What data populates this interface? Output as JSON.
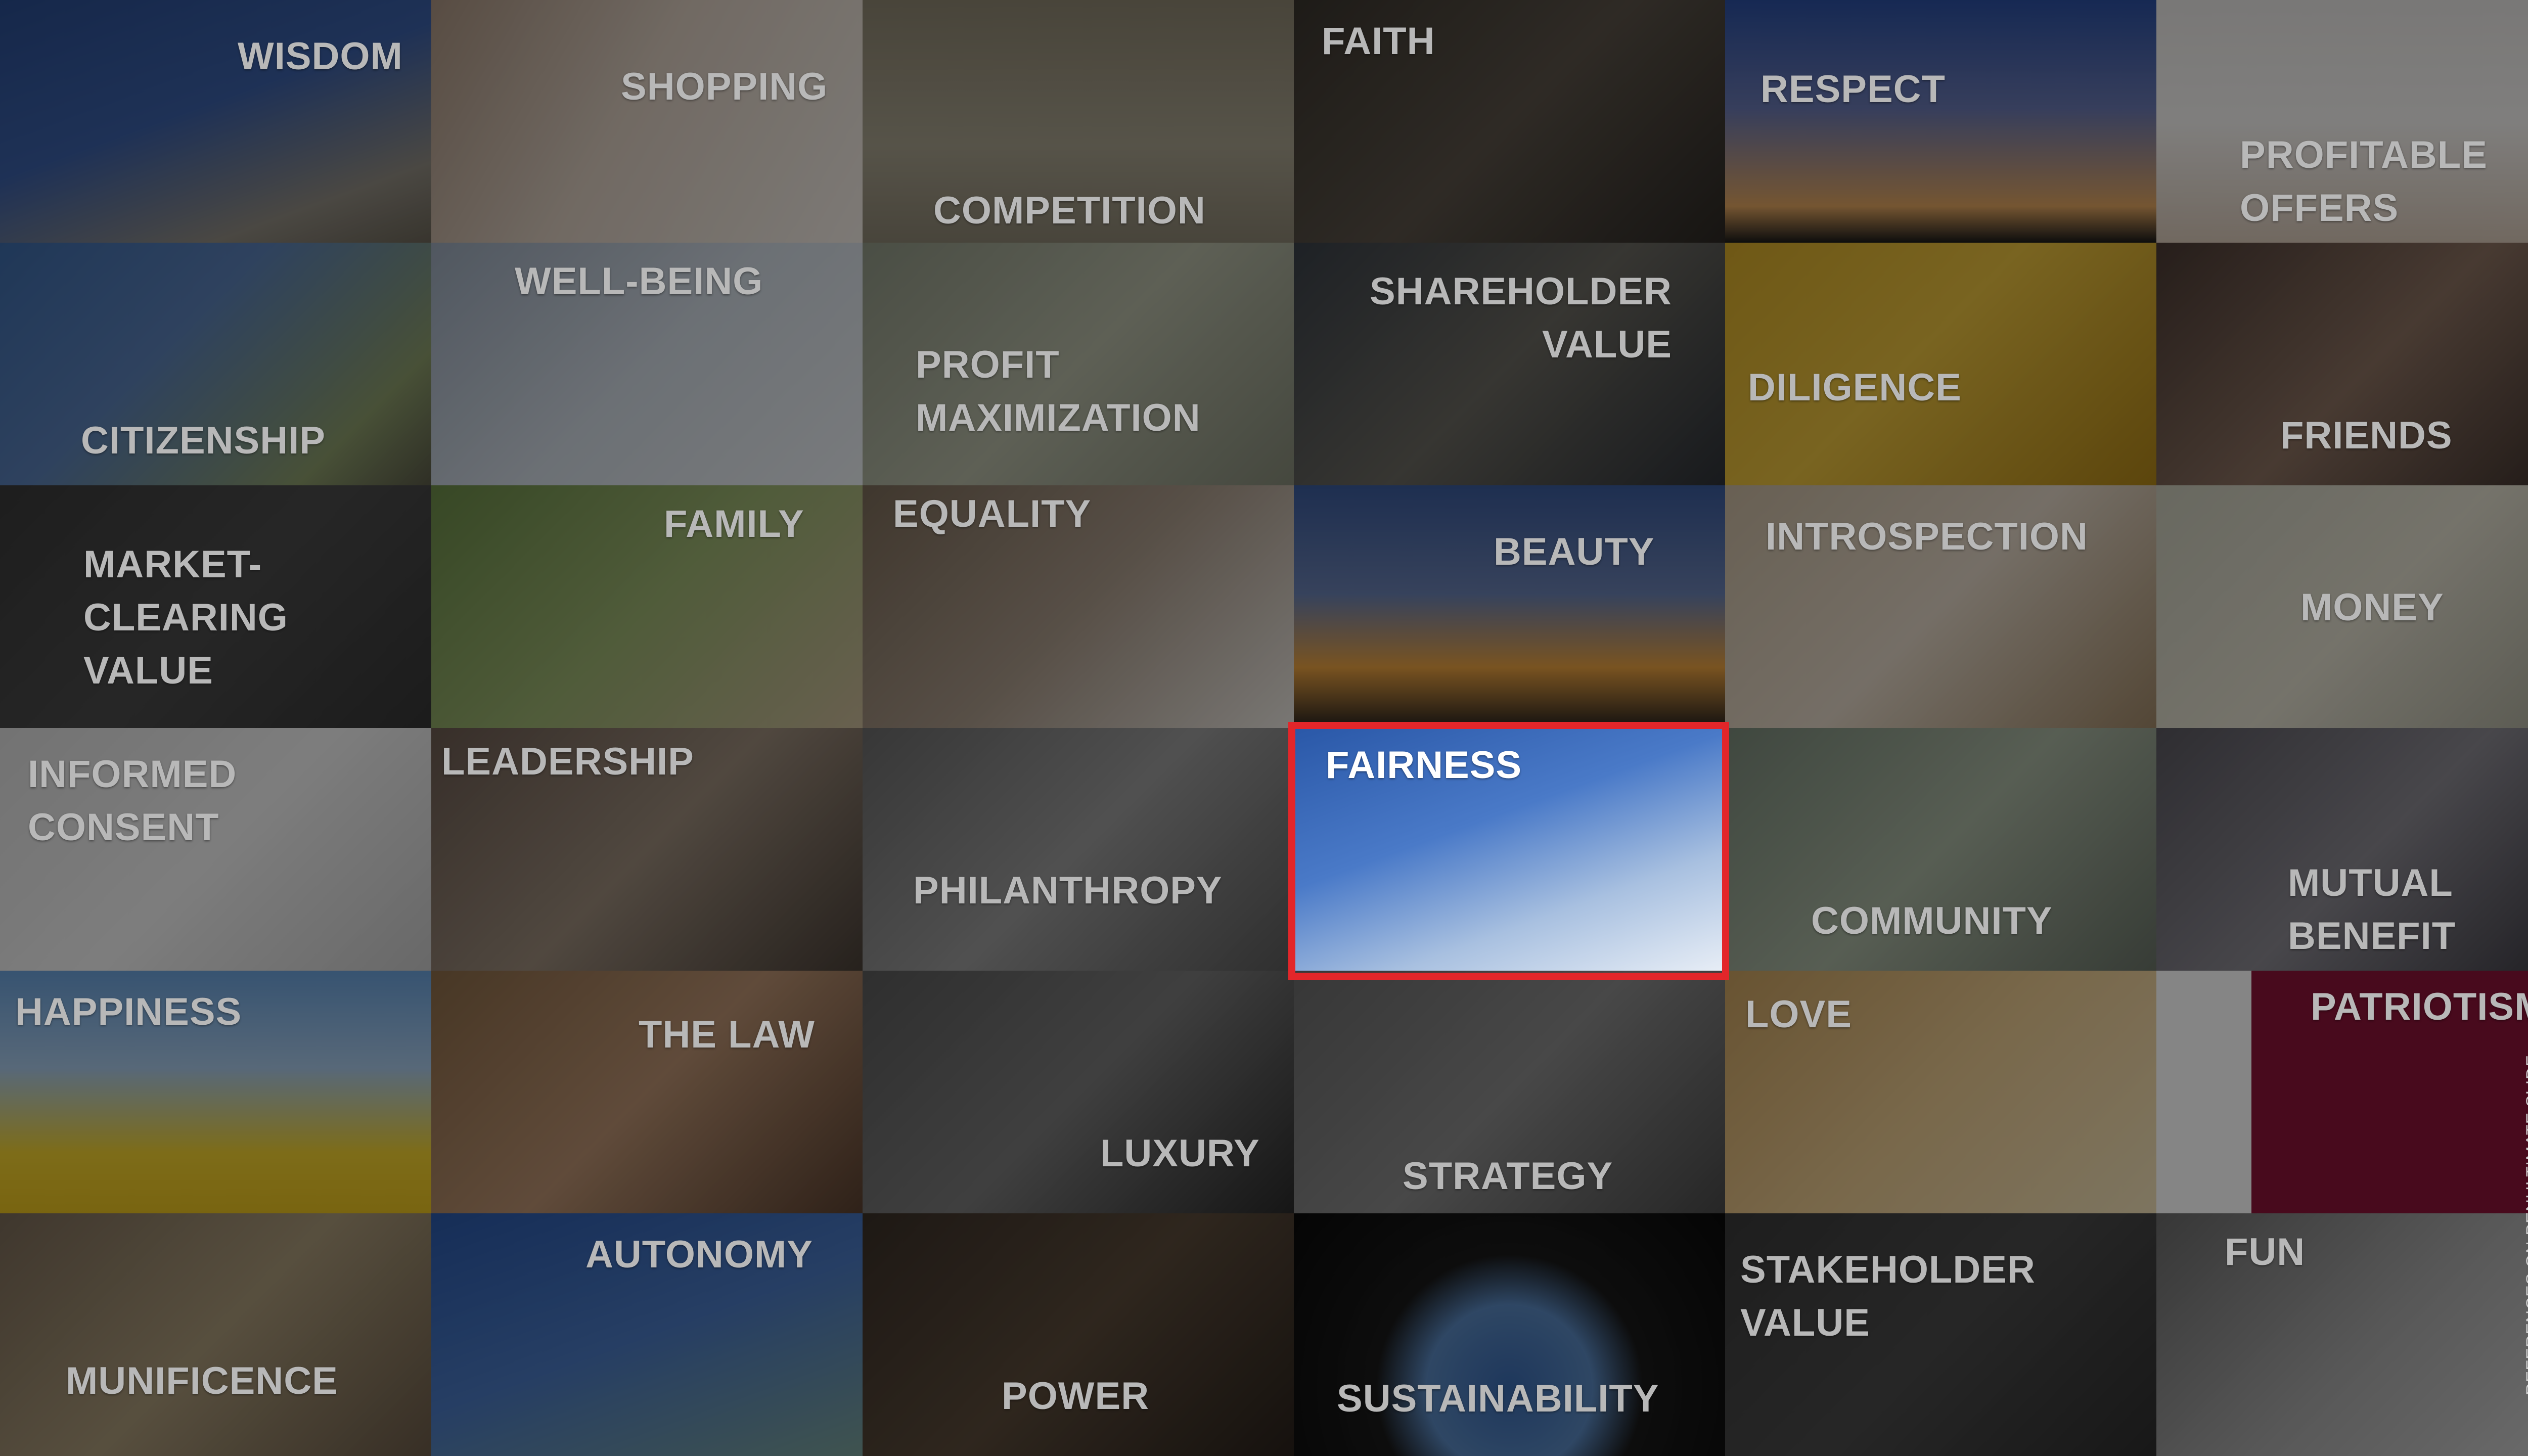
{
  "tiles": [
    {
      "id": "wisdom",
      "label": "WISDOM",
      "bg": "linear-gradient(160deg,#2a4d8f 0%,#3b5fa5 45%,#8f8a80 80%,#6b6558 100%)",
      "highlight": false
    },
    {
      "id": "shopping",
      "label": "SHOPPING",
      "bg": "linear-gradient(120deg,#a89280 0%,#d8cabd 45%,#efe9e2 100%)",
      "highlight": false
    },
    {
      "id": "competition",
      "label": "COMPETITION",
      "bg": "linear-gradient(180deg,#8c8470 0%,#a6a08c 60%,#8b8472 100%)",
      "highlight": false
    },
    {
      "id": "faith",
      "label": "FAITH",
      "bg": "linear-gradient(135deg,#3a352e 0%,#5a5248 50%,#2c2824 100%)",
      "highlight": false
    },
    {
      "id": "respect",
      "label": "RESPECT",
      "bg": "linear-gradient(180deg,#2b4fa0 0%,#6a78b0 45%,#e0a460 85%,#1a1a1a 100%)",
      "highlight": false
    },
    {
      "id": "profitable-offers",
      "label": "PROFITABLE\nOFFERS",
      "bg": "linear-gradient(180deg,#e8e6e4 0%,#f4f2f0 50%,#d8c8b8 100%)",
      "highlight": false
    },
    {
      "id": "citizenship",
      "label": "CITIZENSHIP",
      "bg": "linear-gradient(135deg,#3d6aa8 0%,#5a7fb5 40%,#8a9a6a 80%,#5a5a48 100%)",
      "highlight": false
    },
    {
      "id": "well-being",
      "label": "WELL-BEING",
      "bg": "linear-gradient(135deg,#9aa7b8 0%,#cfd7e0 50%,#e8ecef 100%)",
      "highlight": false
    },
    {
      "id": "profit-maximization",
      "label": "PROFIT\nMAXIMIZATION",
      "bg": "linear-gradient(135deg,#8f9684 0%,#b4b8a4 50%,#858a78 100%)",
      "highlight": false
    },
    {
      "id": "shareholder-value",
      "label": "SHAREHOLDER\nVALUE",
      "bg": "linear-gradient(135deg,#3a4048 0%,#6a6860 50%,#2e3238 100%)",
      "highlight": false
    },
    {
      "id": "diligence",
      "label": "DILIGENCE",
      "bg": "linear-gradient(135deg,#d4a92a 0%,#e8c040 45%,#b08518 100%)",
      "highlight": false
    },
    {
      "id": "friends",
      "label": "FRIENDS",
      "bg": "linear-gradient(135deg,#4a3a34 0%,#8a7060 50%,#3a2e2a 100%)",
      "highlight": false
    },
    {
      "id": "market-clearing-value",
      "label": "MARKET-\nCLEARING\nVALUE",
      "bg": "linear-gradient(135deg,#3a3a3a 0%,#4a4a4a 50%,#363636 100%)",
      "highlight": false
    },
    {
      "id": "family",
      "label": "FAMILY",
      "bg": "linear-gradient(135deg,#6a8a48 0%,#9ab070 50%,#c8b898 100%)",
      "highlight": false
    },
    {
      "id": "equality",
      "label": "EQUALITY",
      "bg": "linear-gradient(135deg,#7a6a58 0%,#a89888 50%,#e8e4de 100%)",
      "highlight": false
    },
    {
      "id": "beauty",
      "label": "BEAUTY",
      "bg": "linear-gradient(180deg,#3a5a9a 0%,#6a80b0 45%,#e8a040 75%,#2a2420 100%)",
      "highlight": false
    },
    {
      "id": "introspection",
      "label": "INTROSPECTION",
      "bg": "linear-gradient(135deg,#c8b8a0 0%,#e0d4c4 50%,#a08868 100%)",
      "highlight": false
    },
    {
      "id": "money",
      "label": "MONEY",
      "bg": "linear-gradient(135deg,#c8c8b8 0%,#e0dccc 50%,#a8a898 100%)",
      "highlight": false
    },
    {
      "id": "informed-consent",
      "label": "INFORMED\nCONSENT",
      "bg": "linear-gradient(135deg,#dcdcdc 0%,#f0f0f0 50%,#c8c8c8 100%)",
      "highlight": false
    },
    {
      "id": "leadership",
      "label": "LEADERSHIP",
      "bg": "linear-gradient(135deg,#6a5a50 0%,#9a8a7a 50%,#4a4038 100%)",
      "highlight": false
    },
    {
      "id": "philanthropy",
      "label": "PHILANTHROPY",
      "bg": "linear-gradient(135deg,#6a6a6a 0%,#9a9a9a 50%,#5a5a5a 100%)",
      "highlight": false
    },
    {
      "id": "fairness",
      "label": "FAIRNESS",
      "bg": "linear-gradient(160deg,#2a58a8 0%,#4a7ac8 40%,#a8c0e0 70%,#e8eef6 100%)",
      "highlight": true
    },
    {
      "id": "community",
      "label": "COMMUNITY",
      "bg": "linear-gradient(135deg,#7a8a7a 0%,#a8b4a0 50%,#6a7468 100%)",
      "highlight": false
    },
    {
      "id": "mutual-benefit",
      "label": "MUTUAL\nBENEFIT",
      "bg": "linear-gradient(135deg,#5a5860 0%,#8a8890 50%,#3a3840 100%)",
      "highlight": false
    },
    {
      "id": "happiness",
      "label": "HAPPINESS",
      "bg": "linear-gradient(180deg,#6aa0d8 0%,#a8c8e8 40%,#f0d030 75%,#e8c020 100%)",
      "highlight": false
    },
    {
      "id": "the-law",
      "label": "THE LAW",
      "bg": "linear-gradient(135deg,#8a6a48 0%,#b89070 50%,#5a4030 100%)",
      "highlight": false
    },
    {
      "id": "luxury",
      "label": "LUXURY",
      "bg": "linear-gradient(135deg,#5a5a5a 0%,#7a7a7a 50%,#2a2a2a 100%)",
      "highlight": false
    },
    {
      "id": "strategy",
      "label": "STRATEGY",
      "bg": "linear-gradient(135deg,#6a6a6a 0%,#8a8a8a 50%,#4a4a4a 100%)",
      "highlight": false
    },
    {
      "id": "love",
      "label": "LOVE",
      "bg": "linear-gradient(135deg,#c8a060 0%,#e8c890 50%,#f0e0b8 100%)",
      "highlight": false
    },
    {
      "id": "patriotism",
      "label": "PATRIOTISM",
      "bg": "linear-gradient(90deg,#ffffff 0%,#ffffff 22%,#8a1538 22%,#8a1538 100%)",
      "highlight": false
    },
    {
      "id": "munificence",
      "label": "MUNIFICENCE",
      "bg": "linear-gradient(135deg,#7a6a58 0%,#a89878 50%,#6a5a48 100%)",
      "highlight": false
    },
    {
      "id": "autonomy",
      "label": "AUTONOMY",
      "bg": "linear-gradient(160deg,#2a58a8 0%,#4a78c0 50%,#7aa098 100%)",
      "highlight": false
    },
    {
      "id": "power",
      "label": "POWER",
      "bg": "linear-gradient(135deg,#3a3028 0%,#5a4a3a 50%,#2a221c 100%)",
      "highlight": false
    },
    {
      "id": "sustainability",
      "label": "SUSTAINABILITY",
      "bg": "radial-gradient(circle at 50% 72%,#3a6ab0 0%,#5a88c0 30%,#1a1a1a 48%,#0a0a0a 100%)",
      "highlight": false
    },
    {
      "id": "stakeholder-value",
      "label": "STAKEHOLDER\nVALUE",
      "bg": "linear-gradient(135deg,#3a3a3a 0%,#4a4a4a 50%,#2e2e2e 100%)",
      "highlight": false
    },
    {
      "id": "fun",
      "label": "FUN",
      "bg": "linear-gradient(135deg,#6a6a6a 0%,#a8a8a8 50%,#d0d0d0 100%)",
      "highlight": false
    }
  ],
  "side_note": "REFERENCES ON PENULTIMATE SLIDE",
  "accent_color": "#e3262a"
}
